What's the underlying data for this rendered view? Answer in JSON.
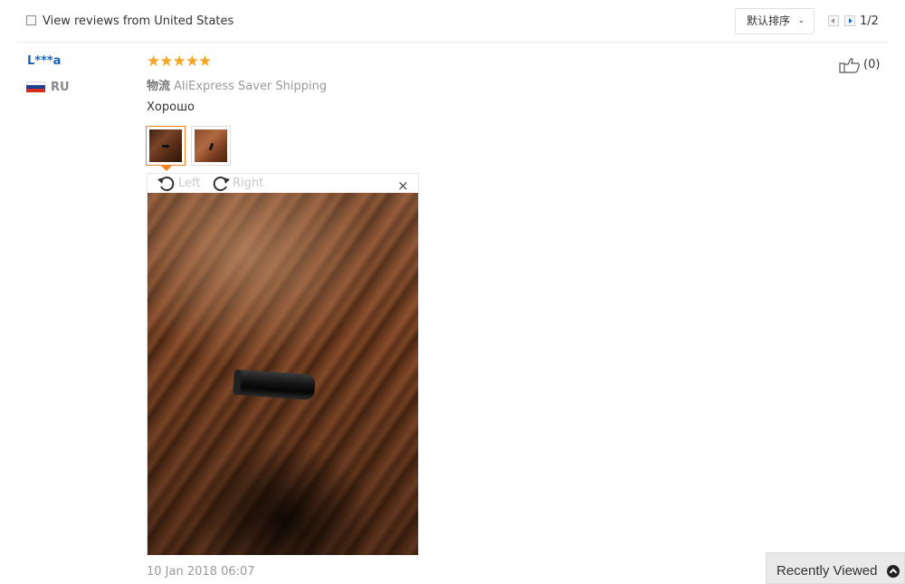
{
  "filter": {
    "checkbox_checked": false,
    "label": "View reviews from United States"
  },
  "sort": {
    "label": "默认排序",
    "icon": "chevron-down-icon"
  },
  "pager": {
    "text": "1/2"
  },
  "review": {
    "reviewer_name": "L***a",
    "country_code": "RU",
    "flag_colors": [
      "#ffffff",
      "#1c3f94",
      "#d52b1e"
    ],
    "rating": 5,
    "stars_text": "★★★★★",
    "star_color": "#f5a623",
    "shipping_prefix": "物流",
    "shipping_method": "AliExpress Saver Shipping",
    "text": "Хорошо",
    "photo_count": 2,
    "selected_photo": 1,
    "viewer": {
      "rotate_left_label": "Left",
      "rotate_right_label": "Right",
      "close_label": "×"
    },
    "timestamp": "10 Jan 2018 06:07",
    "helpful_count": "(0)"
  },
  "recently_viewed": {
    "label": "Recently Viewed"
  },
  "colors": {
    "accent": "#f58220",
    "link": "#1a63b3"
  }
}
